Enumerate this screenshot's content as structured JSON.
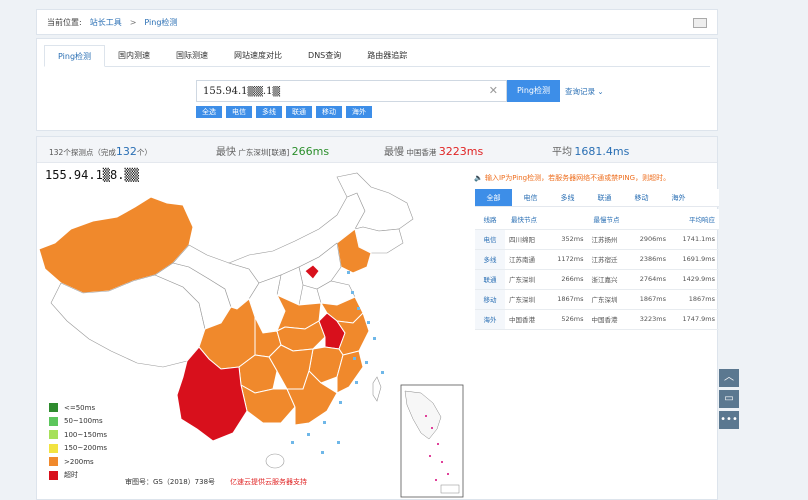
{
  "breadcrumb": {
    "label": "当前位置:",
    "home": "站长工具",
    "sep": ">",
    "current": "Ping检测"
  },
  "tabs": [
    "Ping检测",
    "国内测速",
    "国际测速",
    "网站速度对比",
    "DNS查询",
    "路由器追踪"
  ],
  "search": {
    "value": "155.94.1▒▒.1▒",
    "button": "Ping检测",
    "history": "查询记录"
  },
  "filters": [
    "全选",
    "电信",
    "多线",
    "联通",
    "移动",
    "海外"
  ],
  "stats": {
    "points_prefix": "132个探测点（完成",
    "points_done": "132",
    "points_suffix": "个）",
    "fastest_label": "最快",
    "fastest_node": "广东深圳[联通]",
    "fastest_value": "266ms",
    "slowest_label": "最慢",
    "slowest_node": "中国香港",
    "slowest_value": "3223ms",
    "avg_label": "平均",
    "avg_value": "1681.4ms"
  },
  "ip_display": "155.94.1▒8.▒▒",
  "legend": [
    {
      "label": "<=50ms",
      "color": "#2e8b2e"
    },
    {
      "label": "50~100ms",
      "color": "#5cc65c"
    },
    {
      "label": "100~150ms",
      "color": "#a6e05a"
    },
    {
      "label": "150~200ms",
      "color": "#f2e340"
    },
    {
      "label": ">200ms",
      "color": "#f0892c"
    },
    {
      "label": "超时",
      "color": "#d8101c"
    }
  ],
  "footer": {
    "review_no": "审图号：GS（2018）738号",
    "sponsor": "亿速云提供云服务器支持"
  },
  "tip": "输入IP为Ping检测，若服务器网络不通或禁PING，则超时。",
  "result_tabs": [
    "全部",
    "电信",
    "多线",
    "联通",
    "移动",
    "海外"
  ],
  "table": {
    "headers": [
      "线路",
      "最快节点",
      "最慢节点",
      "平均响应"
    ],
    "rows": [
      {
        "line": "电信",
        "fast_node": "四川绵阳",
        "fast_ms": "352ms",
        "slow_node": "江苏扬州",
        "slow_ms": "2906ms",
        "avg": "1741.1ms"
      },
      {
        "line": "多线",
        "fast_node": "江苏南通",
        "fast_ms": "1172ms",
        "slow_node": "江苏宿迁",
        "slow_ms": "2386ms",
        "avg": "1691.9ms"
      },
      {
        "line": "联通",
        "fast_node": "广东深圳",
        "fast_ms": "266ms",
        "slow_node": "浙江嘉兴",
        "slow_ms": "2764ms",
        "avg": "1429.9ms"
      },
      {
        "line": "移动",
        "fast_node": "广东深圳",
        "fast_ms": "1867ms",
        "slow_node": "广东深圳",
        "slow_ms": "1867ms",
        "avg": "1867ms"
      },
      {
        "line": "海外",
        "fast_node": "中国香港",
        "fast_ms": "526ms",
        "slow_node": "中国香港",
        "slow_ms": "3223ms",
        "avg": "1747.9ms"
      }
    ]
  },
  "colors": {
    "primary": "#3d8ee8",
    "timeout": "#d8101c",
    "slow": "#f0892c"
  }
}
